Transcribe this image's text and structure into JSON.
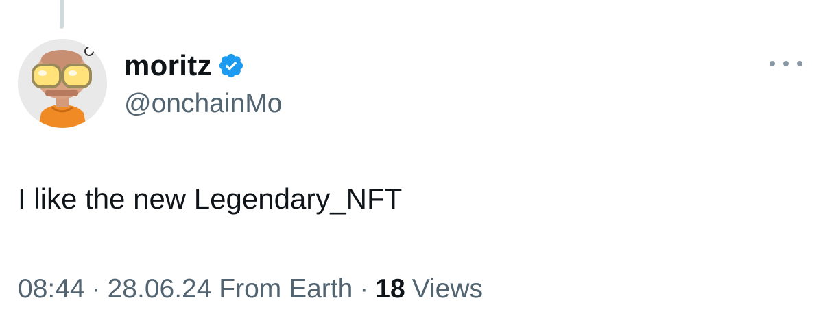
{
  "tweet": {
    "author": {
      "display_name": "moritz",
      "handle": "@onchainMo",
      "verified": true,
      "avatar": "avatar-icon"
    },
    "text": "I like the new Legendary_NFT",
    "meta": {
      "time": "08:44",
      "separator": "·",
      "date_source": "28.06.24 From Earth",
      "views_count": "18",
      "views_label": "Views"
    }
  },
  "icons": {
    "verified": "verified-badge-icon",
    "more": "more-options-icon"
  },
  "colors": {
    "text_primary": "#0f1419",
    "text_secondary": "#536471",
    "verified_blue": "#1d9bf0",
    "thread_line": "#cfd9de"
  }
}
